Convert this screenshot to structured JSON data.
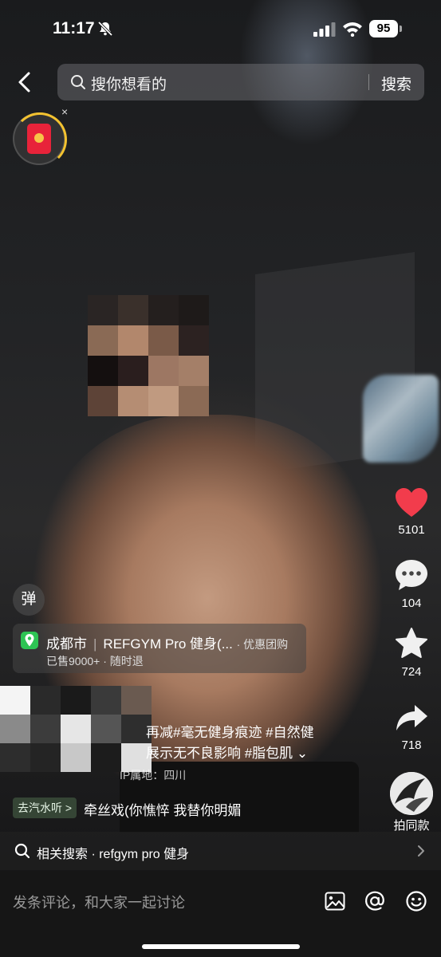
{
  "status": {
    "time": "11:17",
    "battery": "95"
  },
  "search": {
    "placeholder": "搜你想看的",
    "button": "搜索"
  },
  "red_packet": {
    "close": "×"
  },
  "actions": {
    "likes": "5101",
    "comments": "104",
    "favorites": "724",
    "shares": "718"
  },
  "danmaku": {
    "label": "弹"
  },
  "location": {
    "city": "成都市",
    "place": "REFGYM Pro 健身(...",
    "tag": "· 优惠团购",
    "sold": "已售9000+ · 随时退"
  },
  "description": {
    "line1": "再减#毫无健身痕迹 #自然健",
    "line2": "展示无不良影响 #脂包肌 ⌄",
    "ip": "IP属地：四川"
  },
  "music": {
    "tag": "去汽水听 >",
    "text": "牵丝戏(你憔悴 我替你明媚"
  },
  "shoot_same": {
    "label": "拍同款"
  },
  "related": {
    "text": "相关搜索 · refgym pro 健身"
  },
  "comment": {
    "placeholder": "发条评论，和大家一起讨论"
  },
  "colors": {
    "like": "#f23c4c",
    "location_pin": "#2ec454"
  }
}
